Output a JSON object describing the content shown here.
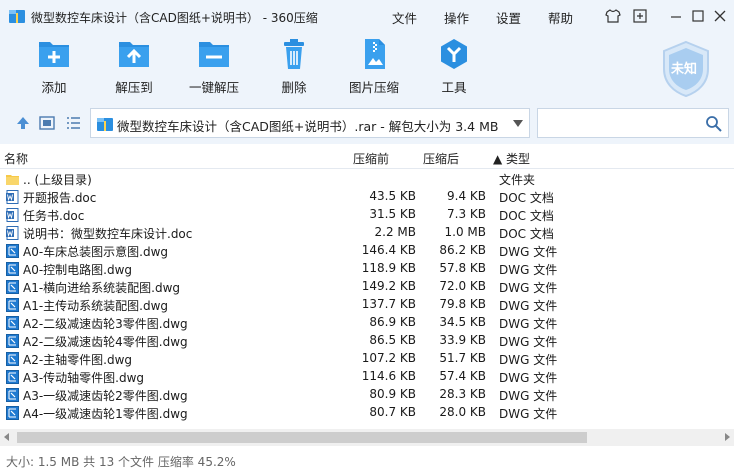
{
  "window": {
    "title": "微型数控车床设计（含CAD图纸+说明书） - 360压缩",
    "menu": [
      "文件",
      "操作",
      "设置",
      "帮助"
    ]
  },
  "toolbar": {
    "add": "添加",
    "extract_to": "解压到",
    "one_click_extract": "一键解压",
    "delete": "删除",
    "image_compress": "图片压缩",
    "tools": "工具",
    "scan_status": "未知"
  },
  "addressbar": {
    "path": "微型数控车床设计（含CAD图纸+说明书）.rar - 解包大小为 3.4 MB",
    "search_placeholder": ""
  },
  "columns": {
    "name": "名称",
    "size": "压缩前",
    "csize": "压缩后",
    "type": "▲ 类型"
  },
  "files": [
    {
      "name": ".. (上级目录)",
      "size": "",
      "csize": "",
      "type": "文件夹",
      "icon": "folder"
    },
    {
      "name": "开题报告.doc",
      "size": "43.5 KB",
      "csize": "9.4 KB",
      "type": "DOC 文档",
      "icon": "doc"
    },
    {
      "name": "任务书.doc",
      "size": "31.5 KB",
      "csize": "7.3 KB",
      "type": "DOC 文档",
      "icon": "doc"
    },
    {
      "name": "说明书：微型数控车床设计.doc",
      "size": "2.2 MB",
      "csize": "1.0 MB",
      "type": "DOC 文档",
      "icon": "doc"
    },
    {
      "name": "A0-车床总装图示意图.dwg",
      "size": "146.4 KB",
      "csize": "86.2 KB",
      "type": "DWG 文件",
      "icon": "dwg"
    },
    {
      "name": "A0-控制电路图.dwg",
      "size": "118.9 KB",
      "csize": "57.8 KB",
      "type": "DWG 文件",
      "icon": "dwg"
    },
    {
      "name": "A1-横向进给系统装配图.dwg",
      "size": "149.2 KB",
      "csize": "72.0 KB",
      "type": "DWG 文件",
      "icon": "dwg"
    },
    {
      "name": "A1-主传动系统装配图.dwg",
      "size": "137.7 KB",
      "csize": "79.8 KB",
      "type": "DWG 文件",
      "icon": "dwg"
    },
    {
      "name": "A2-二级减速齿轮3零件图.dwg",
      "size": "86.9 KB",
      "csize": "34.5 KB",
      "type": "DWG 文件",
      "icon": "dwg"
    },
    {
      "name": "A2-二级减速齿轮4零件图.dwg",
      "size": "86.5 KB",
      "csize": "33.9 KB",
      "type": "DWG 文件",
      "icon": "dwg"
    },
    {
      "name": "A2-主轴零件图.dwg",
      "size": "107.2 KB",
      "csize": "51.7 KB",
      "type": "DWG 文件",
      "icon": "dwg"
    },
    {
      "name": "A3-传动轴零件图.dwg",
      "size": "114.6 KB",
      "csize": "57.4 KB",
      "type": "DWG 文件",
      "icon": "dwg"
    },
    {
      "name": "A3-一级减速齿轮2零件图.dwg",
      "size": "80.9 KB",
      "csize": "28.3 KB",
      "type": "DWG 文件",
      "icon": "dwg"
    },
    {
      "name": "A4-一级减速齿轮1零件图.dwg",
      "size": "80.7 KB",
      "csize": "28.0 KB",
      "type": "DWG 文件",
      "icon": "dwg"
    }
  ],
  "statusbar": {
    "text": "大小: 1.5 MB 共 13 个文件 压缩率 45.2%"
  },
  "colors": {
    "chrome_bg": "#eef4fb",
    "accent": "#2b8fe0",
    "folder": "#f7c948"
  }
}
